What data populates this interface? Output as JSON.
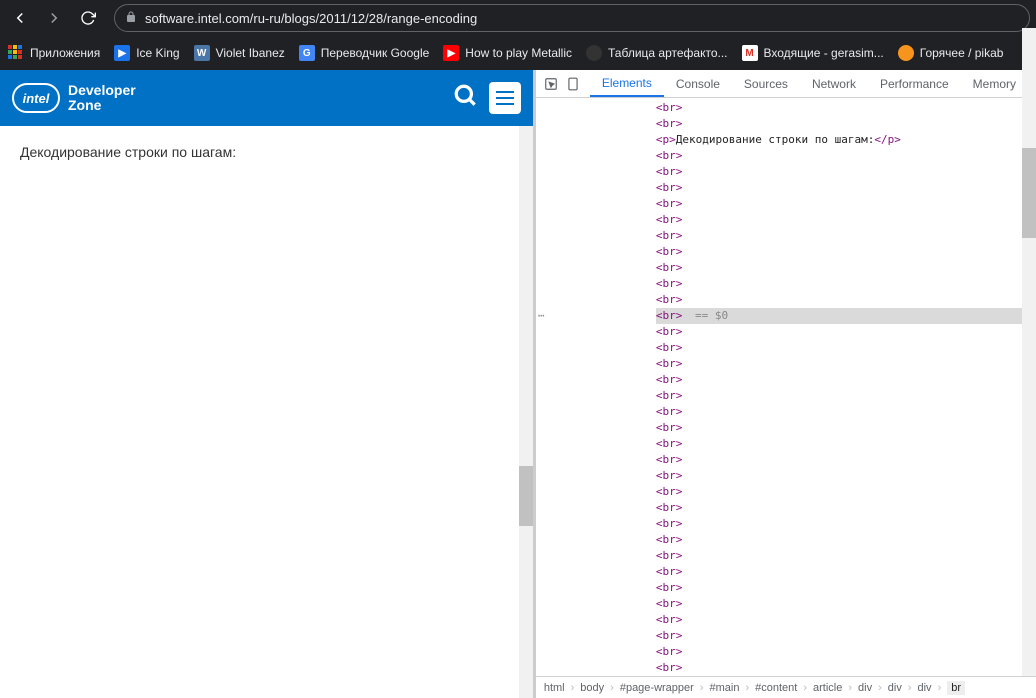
{
  "browser": {
    "url": "software.intel.com/ru-ru/blogs/2011/12/28/range-encoding",
    "apps_label": "Приложения",
    "bookmarks": [
      {
        "icon": "play",
        "label": "Ice King"
      },
      {
        "icon": "vk",
        "label": "Violet Ibanez"
      },
      {
        "icon": "gt",
        "label": "Переводчик Google"
      },
      {
        "icon": "yt",
        "label": "How to play Metallic"
      },
      {
        "icon": "round",
        "label": "Таблица артефакто..."
      },
      {
        "icon": "gmail",
        "label": "Входящие - gerasim..."
      },
      {
        "icon": "pik",
        "label": "Горячее / pikab"
      }
    ]
  },
  "page": {
    "logo_brand": "intel",
    "logo_line1": "Developer",
    "logo_line2": "Zone",
    "content_text": "Декодирование строки по шагам:"
  },
  "devtools": {
    "tabs": [
      "Elements",
      "Console",
      "Sources",
      "Network",
      "Performance",
      "Memory"
    ],
    "active_tab": "Elements",
    "p_text": "Декодирование строки по шагам:",
    "selected_eq": " == $0",
    "breadcrumb": [
      "html",
      "body",
      "#page-wrapper",
      "#main",
      "#content",
      "article",
      "div",
      "div",
      "div",
      "br"
    ]
  }
}
